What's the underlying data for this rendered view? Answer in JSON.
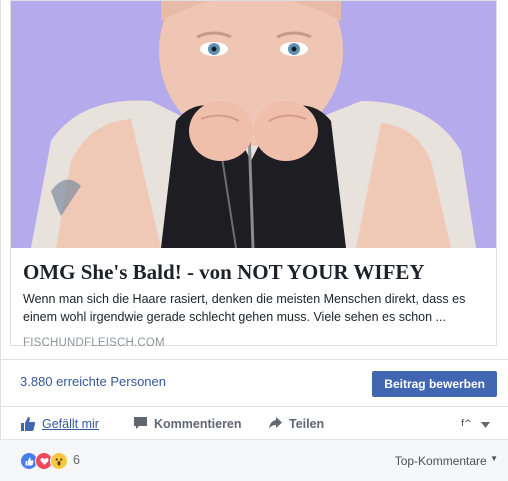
{
  "link_preview": {
    "title": "OMG She's Bald! - von NOT YOUR WIFEY",
    "description": "Wenn man sich die Haare rasiert, denken die meisten Menschen direkt, dass es einem wohl irgendwie gerade schlecht gehen muss. Viele sehen es schon ...",
    "domain": "FISCHUNDFLEISCH.COM",
    "image_background": "#b3a7ea"
  },
  "reach": {
    "text": "3.880 erreichte Personen",
    "boost_label": "Beitrag bewerben",
    "boost_color": "#4267b2"
  },
  "actions": {
    "like_label": "Gefällt mir",
    "comment_label": "Kommentieren",
    "share_label": "Teilen"
  },
  "reactions": {
    "types": [
      "like-icon",
      "love-icon",
      "wow-icon"
    ],
    "count": "6",
    "sort_label": "Top-Kommentare"
  }
}
